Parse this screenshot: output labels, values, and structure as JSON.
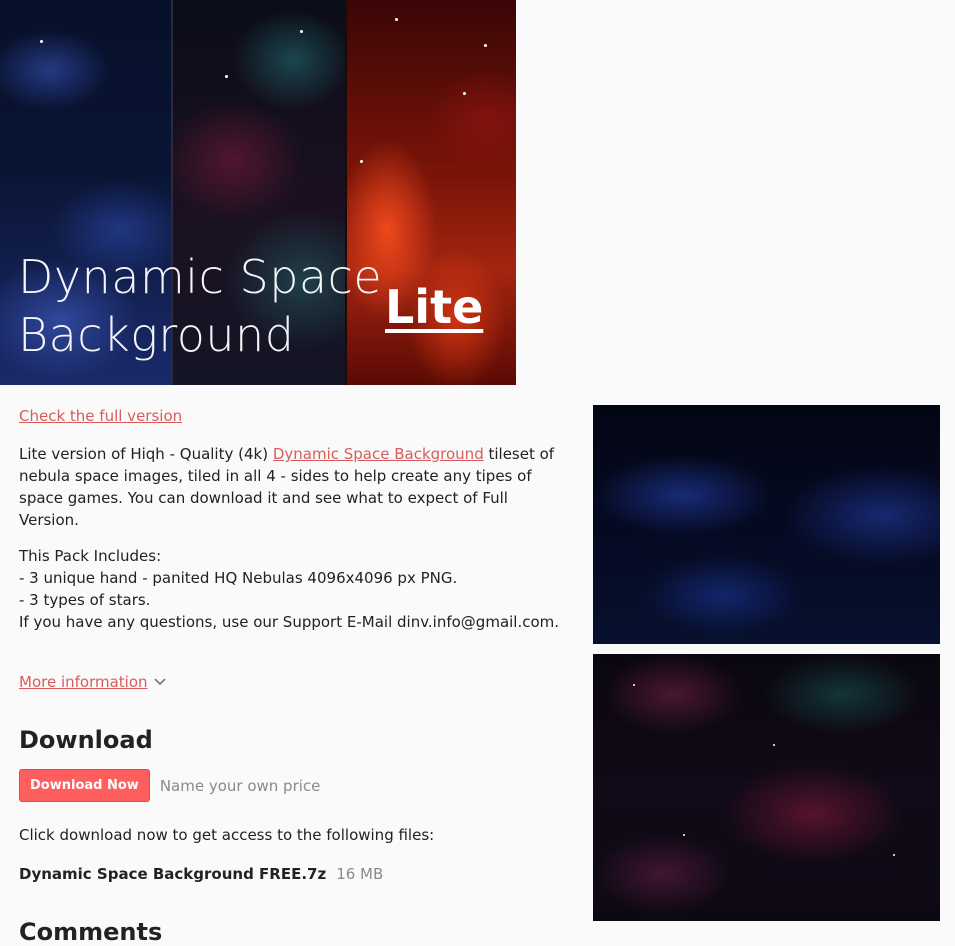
{
  "banner": {
    "title_line1": "Dynamic Space",
    "title_line2": "Background",
    "badge": "Lite"
  },
  "links": {
    "full_version": "Check the full version",
    "more_info": "More information"
  },
  "description": {
    "prefix": "Lite version of Hiqh - Quality (4k) ",
    "link": "Dynamic Space Background",
    "suffix": " tileset of nebula space images, tiled in all 4 - sides to help create any tipes of space games. You can download it and see what to expect of Full Version."
  },
  "includes": {
    "heading": "This Pack Includes:",
    "items": [
      "- 3 unique hand - panited HQ Nebulas 4096x4096 px PNG.",
      "- 3 types of stars."
    ],
    "support": "If you have any questions, use our Support E-Mail dinv.info@gmail.com."
  },
  "download": {
    "heading": "Download",
    "button": "Download Now",
    "price_note": "Name your own price",
    "access_text": "Click download now to get access to the following files:",
    "file_name": "Dynamic Space Background FREE.7z",
    "file_size": "16 MB"
  },
  "comments": {
    "heading": "Comments"
  },
  "icons": {
    "more_info_chevron": "chevron-down-icon"
  }
}
